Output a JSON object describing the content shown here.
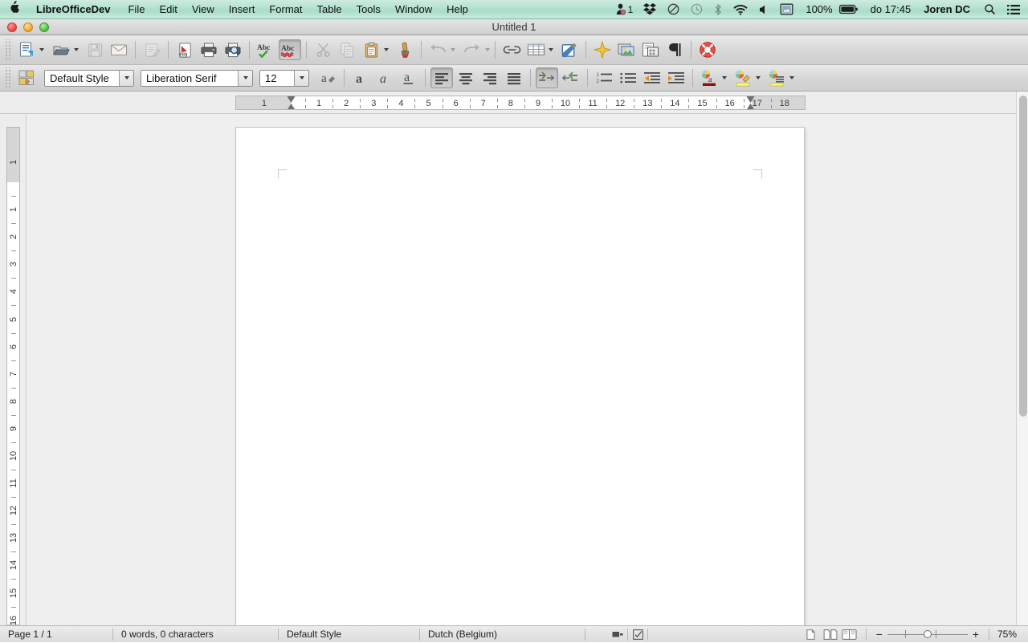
{
  "macmenu": {
    "apple_icon": "apple-logo-icon",
    "app_name": "LibreOfficeDev",
    "items": [
      "File",
      "Edit",
      "View",
      "Insert",
      "Format",
      "Table",
      "Tools",
      "Window",
      "Help"
    ],
    "right": {
      "dropbox_icon": "dropbox-icon",
      "notifier_badge": "1",
      "donotdisturb_icon": "do-not-disturb-icon",
      "timemachine_icon": "clock-icon",
      "bluetooth_icon": "bluetooth-icon",
      "wifi_icon": "wifi-icon",
      "volume_icon": "volume-icon",
      "display_icon": "display-icon",
      "battery_percent": "100%",
      "battery_icon": "battery-icon",
      "clock": "do 17:45",
      "user": "Joren DC",
      "search_icon": "search-icon",
      "notification_center_icon": "list-icon"
    }
  },
  "window": {
    "title": "Untitled 1",
    "close_label": "close",
    "minimize_label": "minimize",
    "zoom_label": "zoom"
  },
  "toolbar": {
    "items": [
      {
        "name": "new-document",
        "icon": "new-doc-icon",
        "enabled": true,
        "dropdown": true
      },
      {
        "name": "open-document",
        "icon": "open-folder-icon",
        "enabled": true,
        "dropdown": true
      },
      {
        "name": "save-document",
        "icon": "save-floppy-icon",
        "enabled": false
      },
      {
        "name": "email-document",
        "icon": "envelope-icon",
        "enabled": true
      },
      {
        "name": "edit-mode",
        "icon": "edit-pencil-icon",
        "enabled": false
      },
      {
        "name": "export-pdf",
        "icon": "pdf-icon",
        "enabled": true
      },
      {
        "name": "print",
        "icon": "printer-icon",
        "enabled": true
      },
      {
        "name": "print-preview",
        "icon": "print-preview-icon",
        "enabled": true
      },
      {
        "name": "spelling",
        "icon": "spellcheck-icon",
        "enabled": true
      },
      {
        "name": "autospellcheck",
        "icon": "autospellcheck-icon",
        "enabled": true,
        "pressed": true
      },
      {
        "name": "cut",
        "icon": "scissors-icon",
        "enabled": false
      },
      {
        "name": "copy",
        "icon": "copy-icon",
        "enabled": false
      },
      {
        "name": "paste",
        "icon": "clipboard-icon",
        "enabled": true,
        "dropdown": true
      },
      {
        "name": "clone-formatting",
        "icon": "paintbrush-icon",
        "enabled": true
      },
      {
        "name": "undo",
        "icon": "undo-arrow-icon",
        "enabled": false,
        "dropdown": true
      },
      {
        "name": "redo",
        "icon": "redo-arrow-icon",
        "enabled": false,
        "dropdown": true
      },
      {
        "name": "hyperlink",
        "icon": "chain-link-icon",
        "enabled": true
      },
      {
        "name": "insert-table",
        "icon": "table-grid-icon",
        "enabled": true,
        "dropdown": true
      },
      {
        "name": "show-draw-functions",
        "icon": "draw-pen-icon",
        "enabled": true
      },
      {
        "name": "insert-special-character",
        "icon": "star-icon",
        "enabled": true
      },
      {
        "name": "insert-image",
        "icon": "image-icon",
        "enabled": true
      },
      {
        "name": "gallery",
        "icon": "gallery-icon",
        "enabled": true
      },
      {
        "name": "formatting-marks",
        "icon": "pilcrow-icon",
        "enabled": true
      },
      {
        "name": "help",
        "icon": "lifebuoy-icon",
        "enabled": true
      }
    ]
  },
  "formatbar": {
    "apply_style_icon": "paragraph-style-icon",
    "paragraph_style": "Default Style",
    "font_name": "Liberation Serif",
    "font_size": "12",
    "character_highlight_icon": "character-format-icon",
    "bold_icon": "bold-icon",
    "italic_icon": "italic-icon",
    "underline_icon": "underline-icon",
    "align_left_icon": "align-left-icon",
    "align_center_icon": "align-center-icon",
    "align_right_icon": "align-right-icon",
    "align_justify_icon": "align-justify-icon",
    "spacing_above_icon": "increase-spacing-icon",
    "spacing_below_icon": "decrease-spacing-icon",
    "ordered_list_icon": "numbered-list-icon",
    "unordered_list_icon": "bullet-list-icon",
    "decrease_indent_icon": "decrease-indent-icon",
    "increase_indent_icon": "increase-indent-icon",
    "font_color_icon": "font-color-icon",
    "font_color": "#8c1111",
    "highlight_icon": "highlighting-icon",
    "highlight_color": "#ffff66",
    "paragraph_background_icon": "paragraph-background-icon",
    "paragraph_background_color": "#ffff66",
    "active": [
      "align-left-icon",
      "increase-spacing-icon"
    ]
  },
  "ruler": {
    "horizontal": {
      "margin_label": "1",
      "numbers": [
        "1",
        "2",
        "3",
        "4",
        "5",
        "6",
        "7",
        "8",
        "9",
        "10",
        "11",
        "12",
        "13",
        "14",
        "15",
        "16",
        "17",
        "18"
      ],
      "unit": "cm",
      "first_indent_marker": "indent-marker-left",
      "right_indent_marker": "indent-marker-right"
    },
    "vertical": {
      "margin_label": "1",
      "numbers": [
        "1",
        "2",
        "3",
        "4",
        "5",
        "6",
        "7",
        "8",
        "9",
        "10",
        "11",
        "12",
        "13",
        "14",
        "15",
        "16"
      ],
      "unit": "cm"
    }
  },
  "document": {
    "content": "",
    "page_count": 1
  },
  "statusbar": {
    "page": "Page 1 / 1",
    "words": "0 words, 0 characters",
    "style": "Default Style",
    "language": "Dutch (Belgium)",
    "selection_mode_icon": "selection-mode-icon",
    "save_state_icon": "document-modified-icon",
    "view_single_icon": "single-page-view-icon",
    "view_multi_icon": "multi-page-view-icon",
    "view_book_icon": "book-view-icon",
    "zoom_out_label": "−",
    "zoom_in_label": "+",
    "zoom_level": "75%"
  }
}
